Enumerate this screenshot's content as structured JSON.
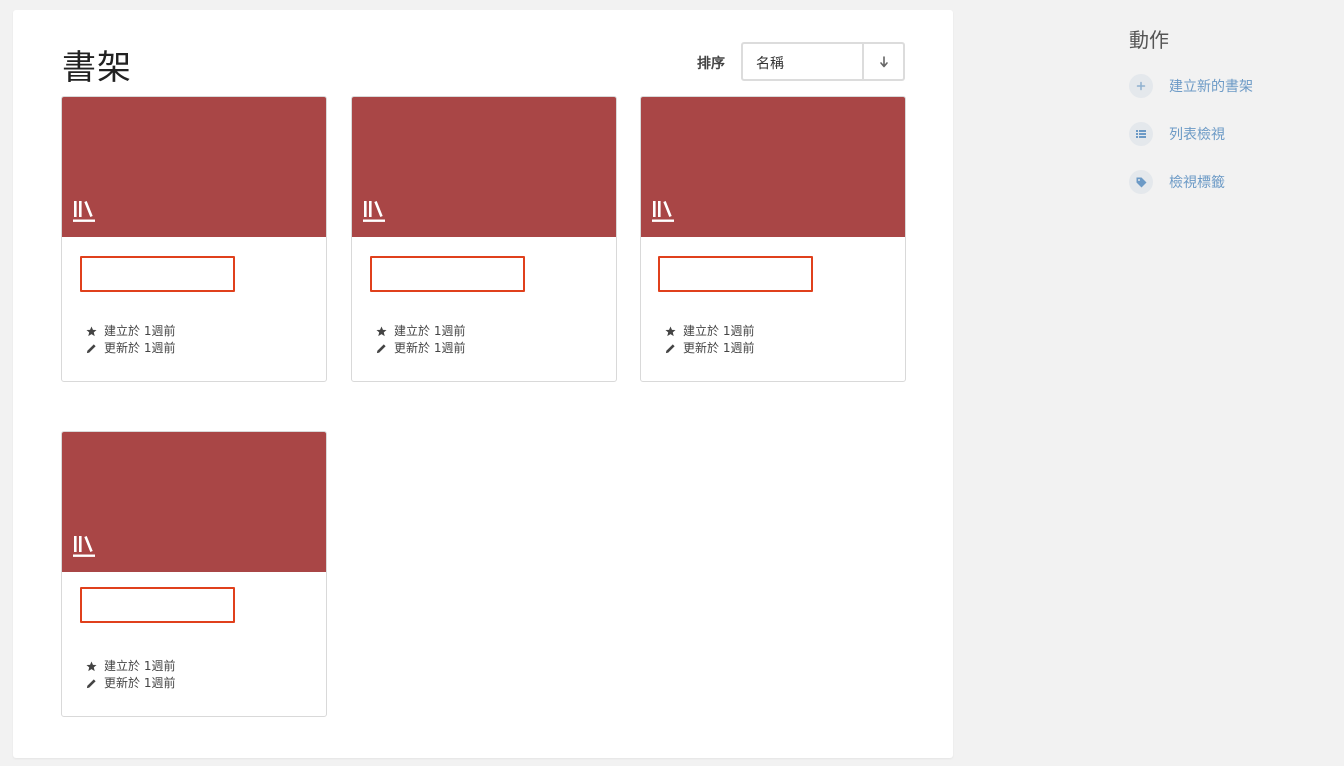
{
  "header": {
    "title": "書架",
    "sort_label": "排序",
    "sort_value": "名稱",
    "sort_direction_icon": "arrow-down-icon"
  },
  "colors": {
    "cover": "#a94646",
    "name_outline": "#e0401c",
    "action_link": "#6c9ac6"
  },
  "shelves": [
    {
      "name": "",
      "created": "建立於 1週前",
      "updated": "更新於 1週前"
    },
    {
      "name": "",
      "created": "建立於 1週前",
      "updated": "更新於 1週前"
    },
    {
      "name": "",
      "created": "建立於 1週前",
      "updated": "更新於 1週前"
    },
    {
      "name": "",
      "created": "建立於 1週前",
      "updated": "更新於 1週前"
    }
  ],
  "actions": {
    "title": "動作",
    "items": [
      {
        "label": "建立新的書架",
        "icon": "plus-icon"
      },
      {
        "label": "列表檢視",
        "icon": "list-icon"
      },
      {
        "label": "檢視標籤",
        "icon": "tag-icon"
      }
    ]
  }
}
